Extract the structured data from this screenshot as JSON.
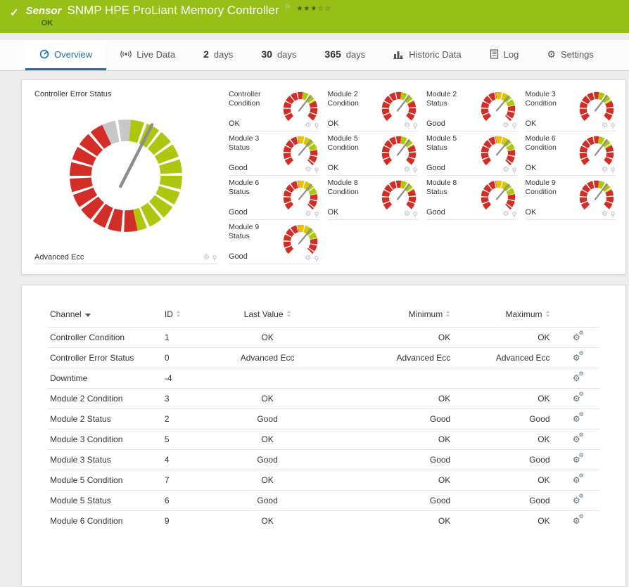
{
  "colors": {
    "header_green": "#96bf17",
    "tab_blue": "#1373ad",
    "gauge_red": "#d22d26",
    "gauge_green": "#aec70e",
    "gauge_yellow": "#e9c303",
    "gauge_gray": "#c8c8c8"
  },
  "icons": {
    "check": "✓",
    "flag": "⚐",
    "gear": "⚙"
  },
  "header": {
    "kind": "Sensor",
    "title": "SNMP HPE ProLiant Memory Controller",
    "status": "OK",
    "rating": "★★★☆☆"
  },
  "tabs": [
    {
      "label": "Overview",
      "active": true
    },
    {
      "label": "Live Data"
    },
    {
      "num": "2",
      "label": "days"
    },
    {
      "num": "30",
      "label": "days"
    },
    {
      "num": "365",
      "label": "days"
    },
    {
      "label": "Historic Data"
    },
    {
      "label": "Log"
    },
    {
      "label": "Settings"
    }
  ],
  "overview": {
    "main_gauge": {
      "label": "Controller Error Status",
      "value": "Advanced Ecc",
      "type": "big"
    },
    "gauges": [
      {
        "label": "Controller Condition",
        "value": "OK",
        "type": "ok"
      },
      {
        "label": "Module 2 Condition",
        "value": "OK",
        "type": "ok"
      },
      {
        "label": "Module 2 Status",
        "value": "Good",
        "type": "good"
      },
      {
        "label": "Module 3 Condition",
        "value": "OK",
        "type": "ok"
      },
      {
        "label": "Module 3 Status",
        "value": "Good",
        "type": "good"
      },
      {
        "label": "Module 5 Condition",
        "value": "OK",
        "type": "ok"
      },
      {
        "label": "Module 5 Status",
        "value": "Good",
        "type": "good"
      },
      {
        "label": "Module 6 Condition",
        "value": "OK",
        "type": "ok"
      },
      {
        "label": "Module 6 Status",
        "value": "Good",
        "type": "good"
      },
      {
        "label": "Module 8 Condition",
        "value": "OK",
        "type": "ok"
      },
      {
        "label": "Module 8 Status",
        "value": "Good",
        "type": "good"
      },
      {
        "label": "Module 9 Condition",
        "value": "OK",
        "type": "ok"
      },
      {
        "label": "Module 9 Status",
        "value": "Good",
        "type": "good"
      }
    ]
  },
  "table": {
    "columns": [
      "Channel",
      "ID",
      "Last Value",
      "Minimum",
      "Maximum"
    ],
    "rows": [
      {
        "channel": "Controller Condition",
        "id": "1",
        "last": "OK",
        "min": "OK",
        "max": "OK"
      },
      {
        "channel": "Controller Error Status",
        "id": "0",
        "last": "Advanced Ecc",
        "min": "Advanced Ecc",
        "max": "Advanced Ecc"
      },
      {
        "channel": "Downtime",
        "id": "-4",
        "last": "",
        "min": "",
        "max": ""
      },
      {
        "channel": "Module 2 Condition",
        "id": "3",
        "last": "OK",
        "min": "OK",
        "max": "OK"
      },
      {
        "channel": "Module 2 Status",
        "id": "2",
        "last": "Good",
        "min": "Good",
        "max": "Good"
      },
      {
        "channel": "Module 3 Condition",
        "id": "5",
        "last": "OK",
        "min": "OK",
        "max": "OK"
      },
      {
        "channel": "Module 3 Status",
        "id": "4",
        "last": "Good",
        "min": "Good",
        "max": "Good"
      },
      {
        "channel": "Module 5 Condition",
        "id": "7",
        "last": "OK",
        "min": "OK",
        "max": "OK"
      },
      {
        "channel": "Module 5 Status",
        "id": "6",
        "last": "Good",
        "min": "Good",
        "max": "Good"
      },
      {
        "channel": "Module 6 Condition",
        "id": "9",
        "last": "OK",
        "min": "OK",
        "max": "OK"
      }
    ]
  }
}
